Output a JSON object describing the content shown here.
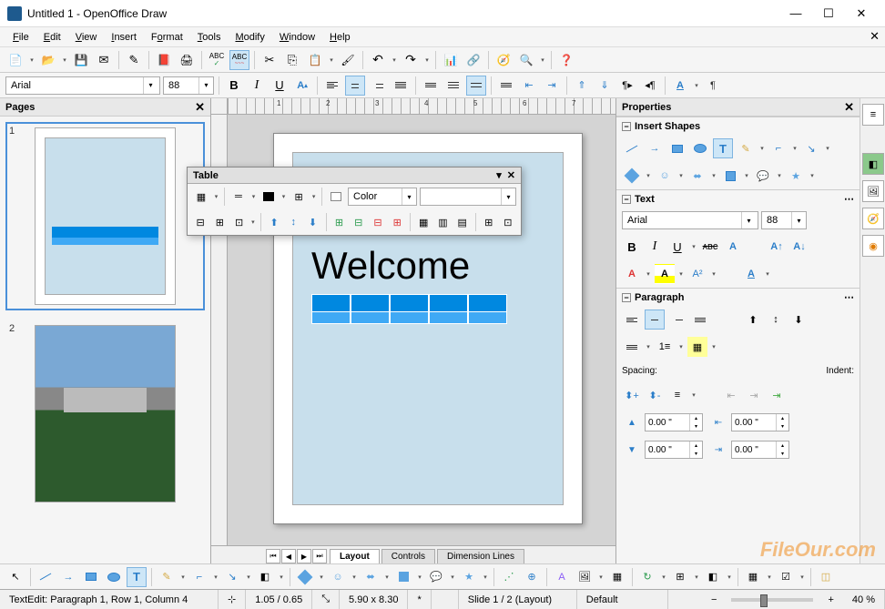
{
  "window": {
    "title": "Untitled 1 - OpenOffice Draw",
    "min": "—",
    "max": "☐",
    "close": "✕"
  },
  "menu": [
    "File",
    "Edit",
    "View",
    "Insert",
    "Format",
    "Tools",
    "Modify",
    "Window",
    "Help"
  ],
  "formatbar": {
    "font": "Arial",
    "size": "88"
  },
  "pages": {
    "title": "Pages",
    "items": [
      "1",
      "2"
    ]
  },
  "canvas": {
    "welcome_text": "Welcome",
    "ruler_nums": [
      "1",
      "2",
      "3",
      "4",
      "5",
      "6",
      "7"
    ]
  },
  "tabs": [
    "Layout",
    "Controls",
    "Dimension Lines"
  ],
  "table_panel": {
    "title": "Table",
    "color_label": "Color"
  },
  "props": {
    "title": "Properties",
    "shapes": "Insert Shapes",
    "text": "Text",
    "paragraph": "Paragraph",
    "font": "Arial",
    "size": "88",
    "spacing": "Spacing:",
    "indent": "Indent:",
    "sp_above": "0.00 \"",
    "sp_below": "0.00 \"",
    "ind_left": "0.00 \"",
    "ind_right": "0.00 \""
  },
  "status": {
    "text_edit": "TextEdit: Paragraph 1, Row 1, Column 4",
    "pos": "1.05 / 0.65",
    "size": "5.90 x 8.30",
    "slide": "Slide 1 / 2 (Layout)",
    "layout": "Default",
    "zoom": "40 %",
    "modified": "*"
  },
  "watermark": "FileOur.com"
}
